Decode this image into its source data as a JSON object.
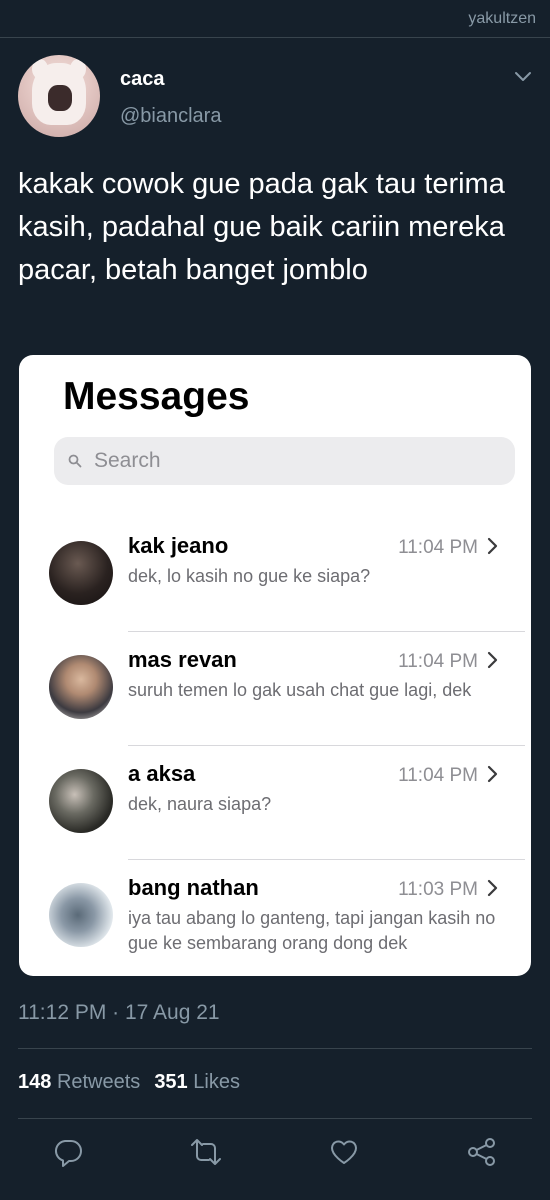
{
  "watermark": "yakultzen",
  "tweet": {
    "display_name": "caca",
    "handle": "@bianclara",
    "text": "kakak cowok gue pada gak tau terima kasih, padahal gue baik cariin mereka pacar, betah banget jomblo",
    "timestamp": "11:12 PM · 17 Aug 21"
  },
  "card": {
    "title": "Messages",
    "search_placeholder": "Search",
    "conversations": [
      {
        "name": "kak jeano",
        "time": "11:04 PM",
        "preview": "dek, lo kasih no gue ke siapa?"
      },
      {
        "name": "mas revan",
        "time": "11:04 PM",
        "preview": "suruh temen lo gak usah chat gue lagi, dek"
      },
      {
        "name": "a aksa",
        "time": "11:04 PM",
        "preview": "dek, naura siapa?"
      },
      {
        "name": "bang nathan",
        "time": "11:03 PM",
        "preview": "iya tau abang lo ganteng, tapi jangan kasih no gue ke sembarang orang dong dek"
      }
    ]
  },
  "stats": {
    "retweets_count": "148",
    "retweets_label": "Retweets",
    "likes_count": "351",
    "likes_label": "Likes"
  },
  "actions": [
    "reply-icon",
    "retweet-icon",
    "like-icon",
    "share-icon"
  ],
  "colors": {
    "background": "#15202b",
    "secondary_text": "#8899a6",
    "divider": "#38444d"
  }
}
